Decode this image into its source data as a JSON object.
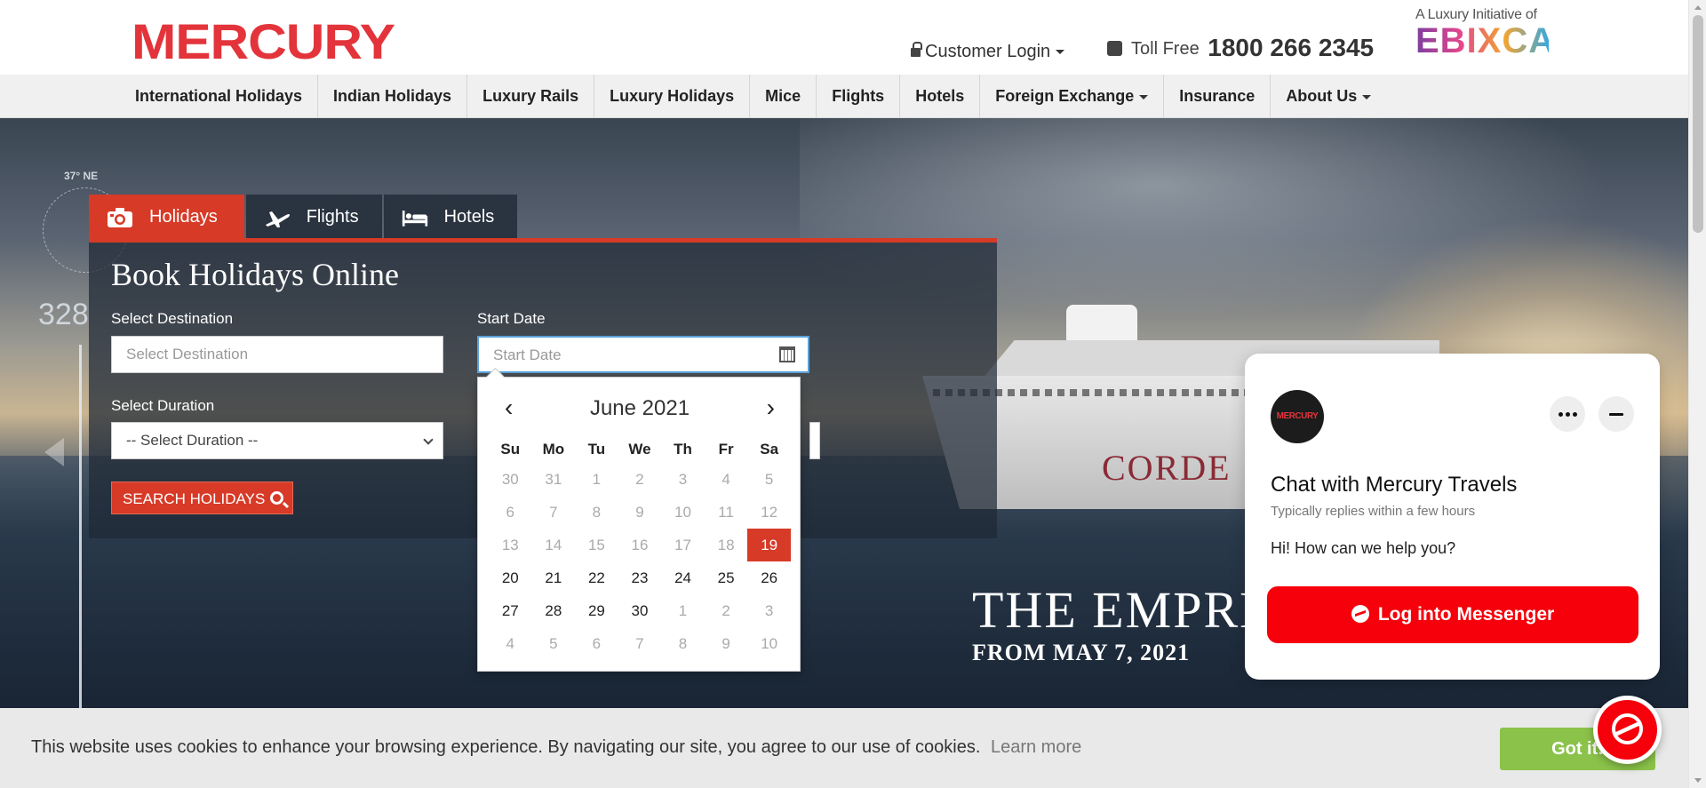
{
  "header": {
    "logo_text": "MERCURY",
    "customer_login": "Customer Login",
    "toll_free_label": "Toll Free",
    "toll_free_number": "1800 266 2345",
    "initiative_tag": "A Luxury Initiative of",
    "initiative_brand": "EBIXCASH"
  },
  "nav": {
    "items": [
      {
        "label": "International Holidays"
      },
      {
        "label": "Indian Holidays"
      },
      {
        "label": "Luxury Rails"
      },
      {
        "label": "Luxury Holidays"
      },
      {
        "label": "Mice"
      },
      {
        "label": "Flights"
      },
      {
        "label": "Hotels"
      },
      {
        "label": "Foreign Exchange"
      },
      {
        "label": "Insurance"
      },
      {
        "label": "About Us"
      }
    ]
  },
  "hero": {
    "compass_deg": "37° NE",
    "compass_big": "328",
    "ship_name": "CORDE",
    "promo_title": "THE EMPRE",
    "promo_sub": "FROM MAY 7, 2021"
  },
  "booking": {
    "tabs": [
      {
        "label": "Holidays",
        "icon": "camera-icon",
        "active": true
      },
      {
        "label": "Flights",
        "icon": "plane-icon"
      },
      {
        "label": "Hotels",
        "icon": "bed-icon"
      }
    ],
    "title": "Book Holidays Online",
    "destination_label": "Select Destination",
    "destination_placeholder": "Select Destination",
    "start_date_label": "Start Date",
    "start_date_placeholder": "Start Date",
    "duration_label": "Select Duration",
    "duration_value": "-- Select Duration --",
    "search_label": "SEARCH HOLIDAYS"
  },
  "datepicker": {
    "prev": "‹",
    "next": "›",
    "month_year": "June 2021",
    "weekdays": [
      "Su",
      "Mo",
      "Tu",
      "We",
      "Th",
      "Fr",
      "Sa"
    ],
    "weeks": [
      [
        {
          "d": "30",
          "m": true
        },
        {
          "d": "31",
          "m": true
        },
        {
          "d": "1",
          "m": true
        },
        {
          "d": "2",
          "m": true
        },
        {
          "d": "3",
          "m": true
        },
        {
          "d": "4",
          "m": true
        },
        {
          "d": "5",
          "m": true
        }
      ],
      [
        {
          "d": "6",
          "m": true
        },
        {
          "d": "7",
          "m": true
        },
        {
          "d": "8",
          "m": true
        },
        {
          "d": "9",
          "m": true
        },
        {
          "d": "10",
          "m": true
        },
        {
          "d": "11",
          "m": true
        },
        {
          "d": "12",
          "m": true
        }
      ],
      [
        {
          "d": "13",
          "m": true
        },
        {
          "d": "14",
          "m": true
        },
        {
          "d": "15",
          "m": true
        },
        {
          "d": "16",
          "m": true
        },
        {
          "d": "17",
          "m": true
        },
        {
          "d": "18",
          "m": true
        },
        {
          "d": "19",
          "s": true
        }
      ],
      [
        {
          "d": "20"
        },
        {
          "d": "21"
        },
        {
          "d": "22"
        },
        {
          "d": "23"
        },
        {
          "d": "24"
        },
        {
          "d": "25"
        },
        {
          "d": "26"
        }
      ],
      [
        {
          "d": "27"
        },
        {
          "d": "28"
        },
        {
          "d": "29"
        },
        {
          "d": "30"
        },
        {
          "d": "1",
          "m": true
        },
        {
          "d": "2",
          "m": true
        },
        {
          "d": "3",
          "m": true
        }
      ],
      [
        {
          "d": "4",
          "m": true
        },
        {
          "d": "5",
          "m": true
        },
        {
          "d": "6",
          "m": true
        },
        {
          "d": "7",
          "m": true
        },
        {
          "d": "8",
          "m": true
        },
        {
          "d": "9",
          "m": true
        },
        {
          "d": "10",
          "m": true
        }
      ]
    ]
  },
  "chat": {
    "avatar_text": "MERCURY",
    "title": "Chat with Mercury Travels",
    "subtitle": "Typically replies within a few hours",
    "message": "Hi! How can we help you?",
    "login_button": "Log into Messenger"
  },
  "cookie": {
    "text": "This website uses cookies to enhance your browsing experience. By navigating our site, you agree to our use of cookies.",
    "learn_more": "Learn more",
    "got_it": "Got it!"
  },
  "colors": {
    "brand_red": "#e3343b",
    "accent_red": "#d73a27",
    "messenger_red": "#f5000b",
    "cookie_green": "#8bc34a"
  }
}
